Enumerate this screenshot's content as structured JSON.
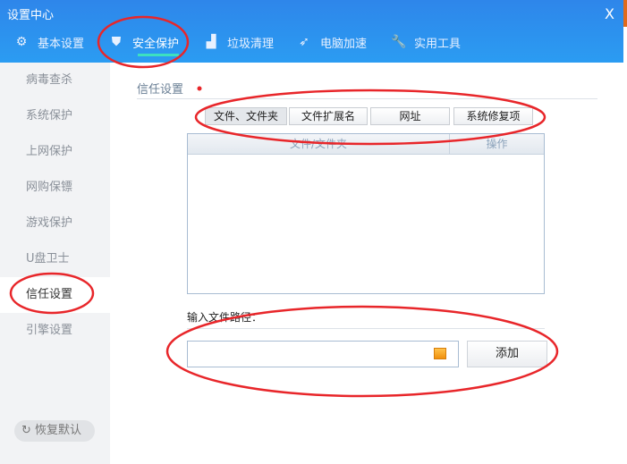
{
  "window": {
    "title": "设置中心",
    "close": "X"
  },
  "tabs": [
    {
      "label": "基本设置",
      "icon": "gear-icon"
    },
    {
      "label": "安全保护",
      "icon": "shield-icon"
    },
    {
      "label": "垃圾清理",
      "icon": "broom-icon"
    },
    {
      "label": "电脑加速",
      "icon": "rocket-icon"
    },
    {
      "label": "实用工具",
      "icon": "wrench-icon"
    }
  ],
  "sidebar": {
    "items": [
      "病毒查杀",
      "系统保护",
      "上网保护",
      "网购保镖",
      "游戏保护",
      "U盘卫士",
      "信任设置",
      "引擎设置"
    ],
    "restore": "恢复默认"
  },
  "main": {
    "section_title": "信任设置",
    "filters": [
      "文件、文件夹",
      "文件扩展名",
      "网址",
      "系统修复项"
    ],
    "columns": [
      "文件/文件夹",
      "操作"
    ],
    "path_label": "输入文件路径：",
    "path_value": "",
    "add": "添加"
  },
  "colors": {
    "header": "#2e86ea",
    "accent": "#3de0c0",
    "annotation": "#e8262a"
  }
}
